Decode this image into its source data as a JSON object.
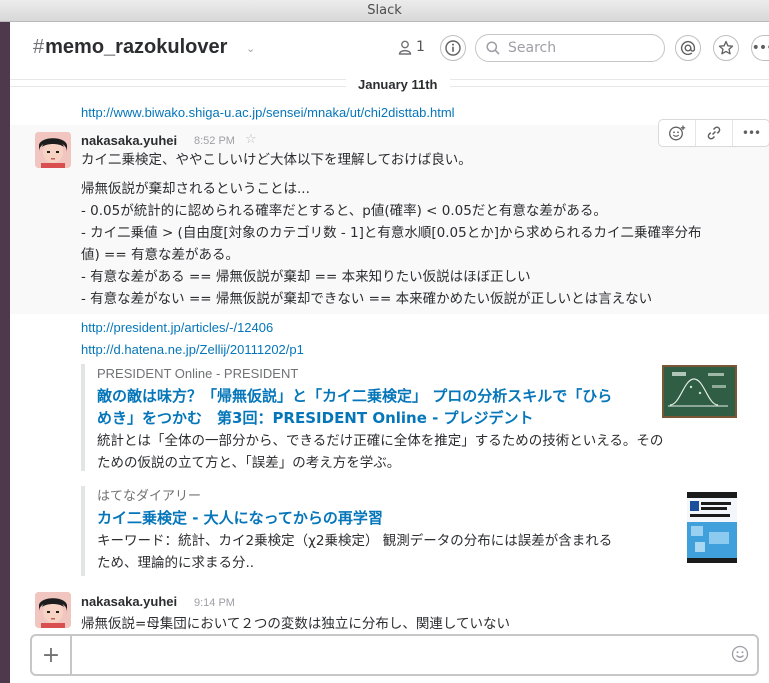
{
  "window": {
    "title": "Slack"
  },
  "channel": {
    "hash": "#",
    "name": "memo_razokulover",
    "member_count": "1"
  },
  "search": {
    "placeholder": "Search"
  },
  "date_divider": "January 11th",
  "previous_link": "http://www.biwako.shiga-u.ac.jp/sensei/mnaka/ut/chi2disttab.html",
  "message1": {
    "author": "nakasaka.yuhei",
    "time": "8:52 PM",
    "lines": [
      "カイ二乗検定、ややこしいけど大体以下を理解しておけば良い。",
      "帰無仮説が棄却されるということは...",
      "- 0.05が統計的に認められる確率だとすると、p値(確率) < 0.05だと有意な差がある。",
      "- カイ二乗値 > (自由度[対象のカテゴリ数 - 1]と有意水順[0.05とか]から求められるカイ二乗確率分布",
      "値) == 有意な差がある。",
      "- 有意な差がある == 帰無仮説が棄却 == 本来知りたい仮説はほぼ正しい",
      "- 有意な差がない == 帰無仮説が棄却できない == 本来確かめたい仮説が正しいとは言えない"
    ],
    "links": [
      "http://president.jp/articles/-/12406",
      "http://d.hatena.ne.jp/Zellij/20111202/p1"
    ],
    "attachments": [
      {
        "service": "PRESIDENT Online - PRESIDENT",
        "title_line1": "敵の敵は味方？「帰無仮説」と「カイ二乗検定」 プロの分析スキルで「ひら",
        "title_line2": "めき」をつかむ　第3回：PRESIDENT Online - プレジデント",
        "text_line1": "統計とは「全体の一部分から、できるだけ正確に全体を推定」するための技術といえる。その",
        "text_line2": "ための仮説の立て方と、「誤差」の考え方を学ぶ。"
      },
      {
        "service": "はてなダイアリー",
        "title_line1": "カイ二乗検定 - 大人になってからの再学習",
        "text_line1": "キーワード：統計、カイ2乗検定（χ2乗検定） 観測データの分布には誤差が含まれる",
        "text_line2": "ため、理論的に求まる分.."
      }
    ]
  },
  "message2": {
    "author": "nakasaka.yuhei",
    "time": "9:14 PM",
    "text": "帰無仮説=母集団において２つの変数は独立に分布し、関連していない"
  },
  "composer": {
    "placeholder": ""
  },
  "colors": {
    "link": "#0576b9",
    "sidebar": "#4d394b",
    "hover_bg": "#f9f9f9"
  }
}
